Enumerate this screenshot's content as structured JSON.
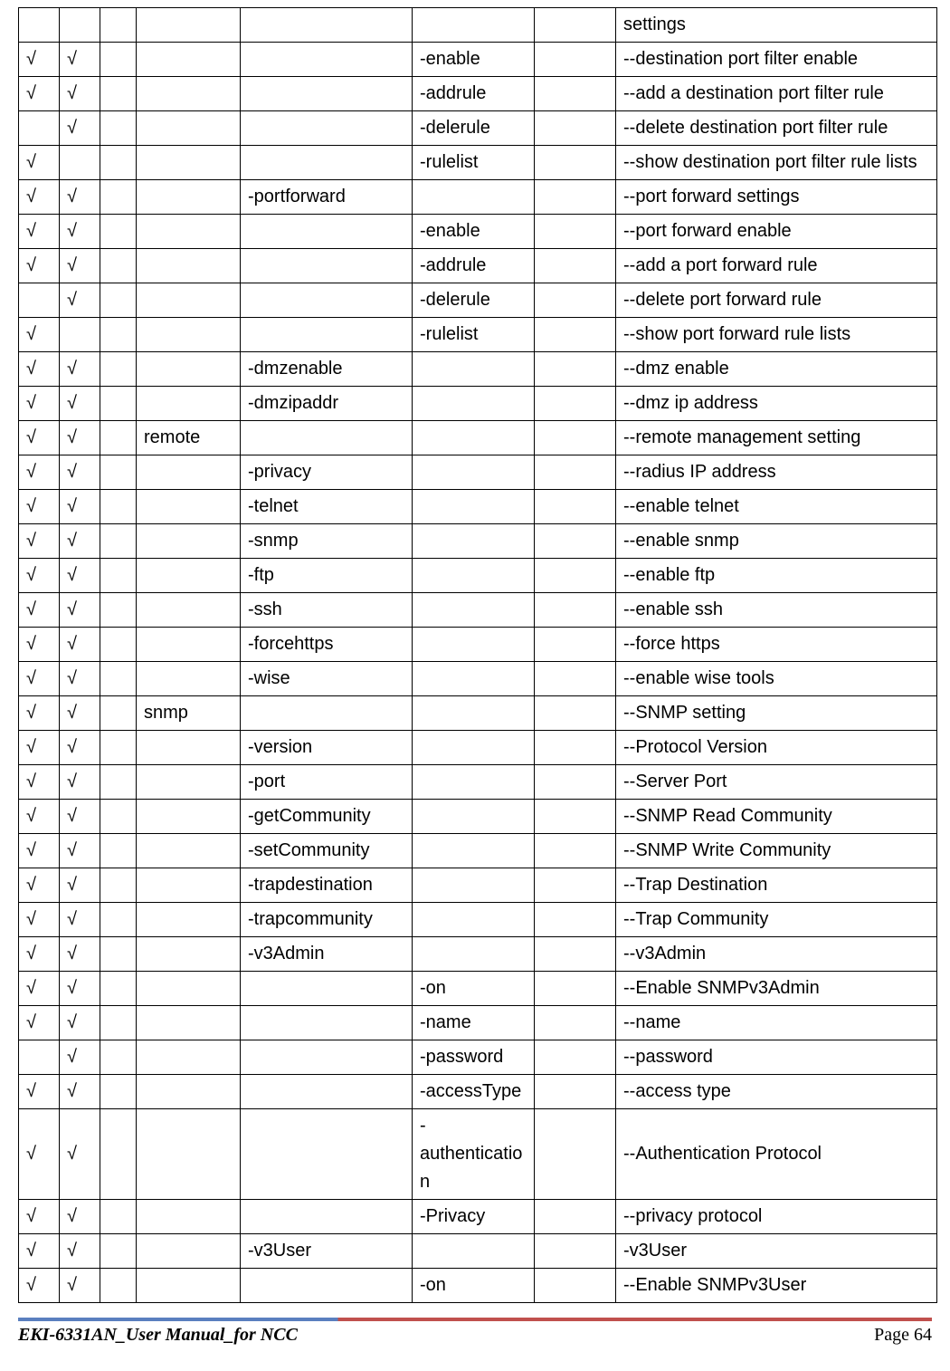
{
  "check_mark": "√",
  "columns": [
    45,
    45,
    40,
    115,
    190,
    135,
    90,
    355
  ],
  "rows": [
    {
      "c": [
        "",
        "",
        "",
        "",
        "",
        "",
        "",
        "settings"
      ]
    },
    {
      "c": [
        "√",
        "√",
        "",
        "",
        "",
        "-enable",
        "",
        "--destination port filter enable"
      ]
    },
    {
      "c": [
        "√",
        "√",
        "",
        "",
        "",
        "-addrule",
        "",
        "--add a destination port filter rule"
      ]
    },
    {
      "c": [
        "",
        "√",
        "",
        "",
        "",
        "-delerule",
        "",
        "--delete destination port filter rule"
      ]
    },
    {
      "c": [
        "√",
        "",
        "",
        "",
        "",
        "-rulelist",
        "",
        "--show destination port filter rule lists"
      ]
    },
    {
      "c": [
        "√",
        "√",
        "",
        "",
        "-portforward",
        "",
        "",
        "--port forward settings"
      ]
    },
    {
      "c": [
        "√",
        "√",
        "",
        "",
        "",
        "-enable",
        "",
        "--port forward enable"
      ]
    },
    {
      "c": [
        "√",
        "√",
        "",
        "",
        "",
        "-addrule",
        "",
        "--add a port forward rule"
      ]
    },
    {
      "c": [
        "",
        "√",
        "",
        "",
        "",
        "-delerule",
        "",
        "--delete port forward rule"
      ]
    },
    {
      "c": [
        "√",
        "",
        "",
        "",
        "",
        "-rulelist",
        "",
        "--show port forward rule lists"
      ]
    },
    {
      "c": [
        "√",
        "√",
        "",
        "",
        "-dmzenable",
        "",
        "",
        "--dmz enable"
      ]
    },
    {
      "c": [
        "√",
        "√",
        "",
        "",
        "-dmzipaddr",
        "",
        "",
        "--dmz ip address"
      ]
    },
    {
      "c": [
        "√",
        "√",
        "",
        "remote",
        "",
        "",
        "",
        "--remote management setting"
      ]
    },
    {
      "c": [
        "√",
        "√",
        "",
        "",
        "-privacy",
        "",
        "",
        "--radius IP address"
      ]
    },
    {
      "c": [
        "√",
        "√",
        "",
        "",
        "-telnet",
        "",
        "",
        "--enable telnet"
      ]
    },
    {
      "c": [
        "√",
        "√",
        "",
        "",
        "-snmp",
        "",
        "",
        "--enable snmp"
      ]
    },
    {
      "c": [
        "√",
        "√",
        "",
        "",
        "-ftp",
        "",
        "",
        "--enable ftp"
      ]
    },
    {
      "c": [
        "√",
        "√",
        "",
        "",
        "-ssh",
        "",
        "",
        "--enable ssh"
      ]
    },
    {
      "c": [
        "√",
        "√",
        "",
        "",
        "-forcehttps",
        "",
        "",
        "--force https"
      ]
    },
    {
      "c": [
        "√",
        "√",
        "",
        "",
        "-wise",
        "",
        "",
        "--enable wise tools"
      ]
    },
    {
      "c": [
        "√",
        "√",
        "",
        "snmp",
        "",
        "",
        "",
        "--SNMP setting"
      ]
    },
    {
      "c": [
        "√",
        "√",
        "",
        "",
        "-version",
        "",
        "",
        "--Protocol Version"
      ]
    },
    {
      "c": [
        "√",
        "√",
        "",
        "",
        "-port",
        "",
        "",
        "--Server Port"
      ]
    },
    {
      "c": [
        "√",
        "√",
        "",
        "",
        "-getCommunity",
        "",
        "",
        "--SNMP Read Community"
      ]
    },
    {
      "c": [
        "√",
        "√",
        "",
        "",
        "-setCommunity",
        "",
        "",
        "--SNMP Write Community"
      ]
    },
    {
      "c": [
        "√",
        "√",
        "",
        "",
        "-trapdestination",
        "",
        "",
        "--Trap Destination"
      ]
    },
    {
      "c": [
        "√",
        "√",
        "",
        "",
        "-trapcommunity",
        "",
        "",
        "--Trap Community"
      ]
    },
    {
      "c": [
        "√",
        "√",
        "",
        "",
        "-v3Admin",
        "",
        "",
        "--v3Admin"
      ]
    },
    {
      "c": [
        "√",
        "√",
        "",
        "",
        "",
        "-on",
        "",
        "--Enable SNMPv3Admin"
      ]
    },
    {
      "c": [
        "√",
        "√",
        "",
        "",
        "",
        "-name",
        "",
        "--name"
      ]
    },
    {
      "c": [
        "",
        "√",
        "",
        "",
        "",
        "-password",
        "",
        "--password"
      ]
    },
    {
      "c": [
        "√",
        "√",
        "",
        "",
        "",
        "-accessType",
        "",
        "--access type"
      ]
    },
    {
      "c": [
        "√",
        "√",
        "",
        "",
        "",
        "-authentication",
        "",
        "--Authentication Protocol"
      ]
    },
    {
      "c": [
        "√",
        "√",
        "",
        "",
        "",
        "-Privacy",
        "",
        "--privacy protocol"
      ]
    },
    {
      "c": [
        "√",
        "√",
        "",
        "",
        "-v3User",
        "",
        "",
        "-v3User"
      ]
    },
    {
      "c": [
        "√",
        "√",
        "",
        "",
        "",
        "-on",
        "",
        "--Enable SNMPv3User"
      ]
    }
  ],
  "footer": {
    "left": "EKI-6331AN_User Manual_for NCC",
    "right": "Page 64"
  }
}
